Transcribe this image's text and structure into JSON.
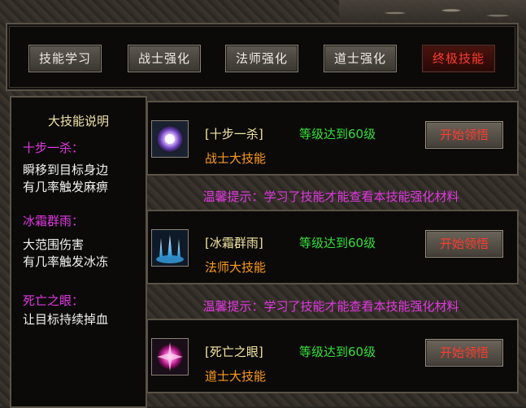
{
  "tabs": [
    "技能学习",
    "战士强化",
    "法师强化",
    "道士强化",
    "终极技能"
  ],
  "active_tab": "终极技能",
  "info": {
    "title": "大技能说明",
    "entries": [
      {
        "name": "十步一杀：",
        "desc": [
          "瞬移到目标身边",
          "有几率触发麻痹"
        ]
      },
      {
        "name": "冰霜群雨：",
        "desc": [
          "大范围伤害",
          "有几率触发冰冻"
        ]
      },
      {
        "name": "死亡之眼：",
        "desc": [
          "让目标持续掉血"
        ]
      }
    ]
  },
  "skills": [
    {
      "name": "[十步一杀]",
      "requirement": "等级达到60级",
      "class_label": "战士大技能",
      "button": "开始领悟",
      "icon": "purple-orb-icon"
    },
    {
      "name": "[冰霜群雨]",
      "requirement": "等级达到60级",
      "class_label": "法师大技能",
      "button": "开始领悟",
      "icon": "ice-rain-icon"
    },
    {
      "name": "[死亡之眼]",
      "requirement": "等级达到60级",
      "class_label": "道士大技能",
      "button": "开始领悟",
      "icon": "death-eye-icon"
    }
  ],
  "tip": "温馨提示：学习了技能才能查看本技能强化材料",
  "colors": {
    "active_tab_text": "#ff3b2e",
    "requirement_green": "#34e03a",
    "tip_magenta": "#e238e2",
    "class_orange": "#ff9b1a"
  }
}
